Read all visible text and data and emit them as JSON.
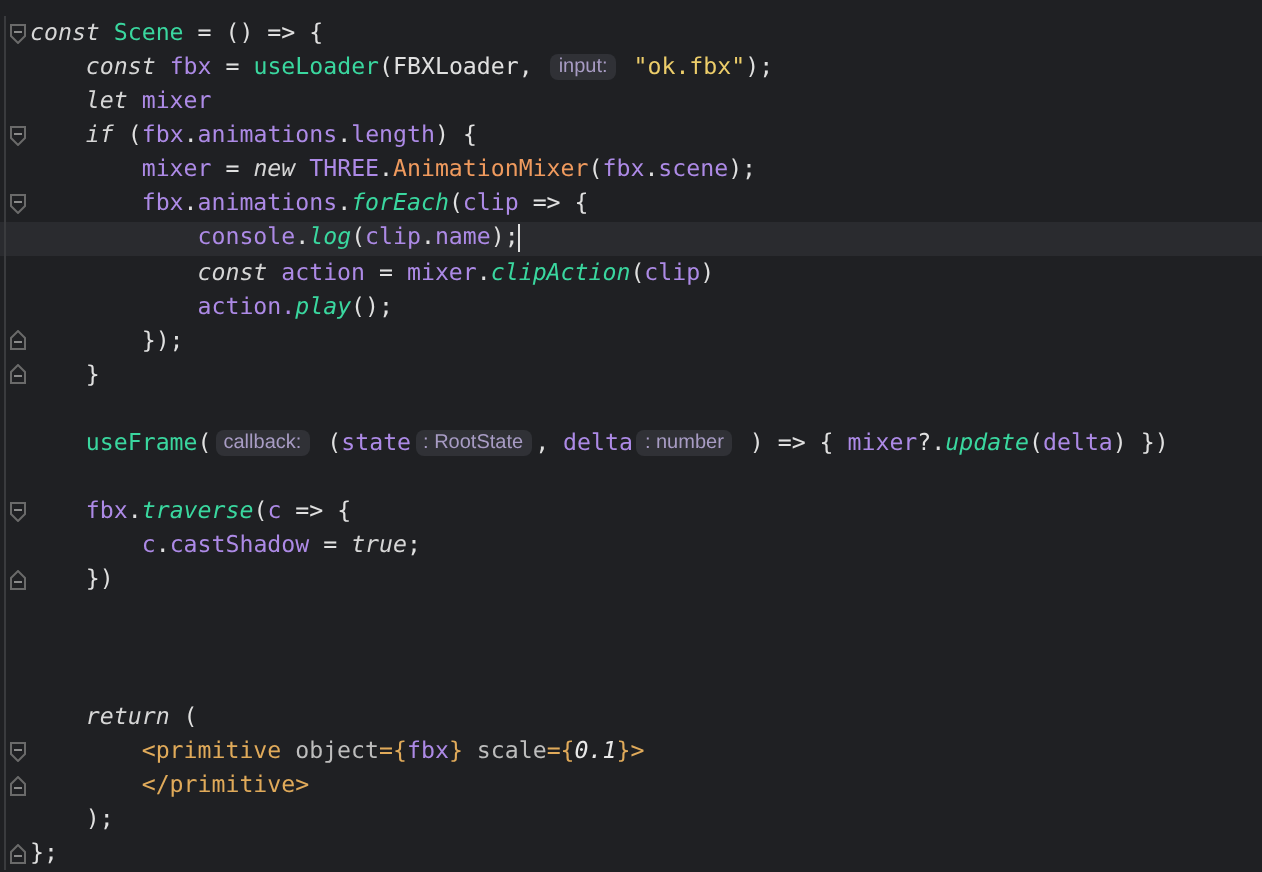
{
  "editor": {
    "lines": [
      {
        "fold_open": true,
        "fold_close": false,
        "current": false,
        "tokens": [
          {
            "text": "const ",
            "kind": "kw"
          },
          {
            "text": "Scene",
            "kind": "fn"
          },
          {
            "text": " = () => {",
            "kind": "plain"
          }
        ]
      },
      {
        "fold_open": false,
        "fold_close": false,
        "current": false,
        "tokens": [
          {
            "text": "    const ",
            "kind": "kw"
          },
          {
            "text": "fbx",
            "kind": "var"
          },
          {
            "text": " = ",
            "kind": "plain"
          },
          {
            "text": "useLoader",
            "kind": "fn"
          },
          {
            "text": "(FBXLoader, ",
            "kind": "plain"
          },
          {
            "text": "input:",
            "kind": "hint"
          },
          {
            "text": " \"ok.fbx\"",
            "kind": "str"
          },
          {
            "text": ");",
            "kind": "plain"
          }
        ]
      },
      {
        "fold_open": false,
        "fold_close": false,
        "current": false,
        "tokens": [
          {
            "text": "    let ",
            "kind": "kw"
          },
          {
            "text": "mixer",
            "kind": "var"
          }
        ]
      },
      {
        "fold_open": true,
        "fold_close": false,
        "current": false,
        "tokens": [
          {
            "text": "    if",
            "kind": "kw"
          },
          {
            "text": " (",
            "kind": "plain"
          },
          {
            "text": "fbx",
            "kind": "var"
          },
          {
            "text": ".",
            "kind": "plain"
          },
          {
            "text": "animations",
            "kind": "var"
          },
          {
            "text": ".",
            "kind": "plain"
          },
          {
            "text": "length",
            "kind": "var"
          },
          {
            "text": ") {",
            "kind": "plain"
          }
        ]
      },
      {
        "fold_open": false,
        "fold_close": false,
        "current": false,
        "tokens": [
          {
            "text": "        mixer",
            "kind": "var"
          },
          {
            "text": " = ",
            "kind": "plain"
          },
          {
            "text": "new ",
            "kind": "kw"
          },
          {
            "text": "THREE",
            "kind": "var"
          },
          {
            "text": ".",
            "kind": "plain"
          },
          {
            "text": "AnimationMixer",
            "kind": "cls"
          },
          {
            "text": "(",
            "kind": "plain"
          },
          {
            "text": "fbx",
            "kind": "var"
          },
          {
            "text": ".",
            "kind": "plain"
          },
          {
            "text": "scene",
            "kind": "var"
          },
          {
            "text": ");",
            "kind": "plain"
          }
        ]
      },
      {
        "fold_open": true,
        "fold_close": false,
        "current": false,
        "tokens": [
          {
            "text": "        fbx",
            "kind": "var"
          },
          {
            "text": ".",
            "kind": "plain"
          },
          {
            "text": "animations",
            "kind": "var"
          },
          {
            "text": ".",
            "kind": "plain"
          },
          {
            "text": "forEach",
            "kind": "method"
          },
          {
            "text": "(",
            "kind": "plain"
          },
          {
            "text": "clip",
            "kind": "var"
          },
          {
            "text": " => {",
            "kind": "plain"
          }
        ]
      },
      {
        "fold_open": false,
        "fold_close": false,
        "current": true,
        "tokens": [
          {
            "text": "            console",
            "kind": "var"
          },
          {
            "text": ".",
            "kind": "plain"
          },
          {
            "text": "log",
            "kind": "method"
          },
          {
            "text": "(",
            "kind": "plain"
          },
          {
            "text": "clip",
            "kind": "var"
          },
          {
            "text": ".",
            "kind": "plain"
          },
          {
            "text": "name",
            "kind": "var"
          },
          {
            "text": ");",
            "kind": "plain"
          }
        ]
      },
      {
        "fold_open": false,
        "fold_close": false,
        "current": false,
        "tokens": [
          {
            "text": "            const ",
            "kind": "kw"
          },
          {
            "text": "action",
            "kind": "var"
          },
          {
            "text": " = ",
            "kind": "plain"
          },
          {
            "text": "mixer",
            "kind": "var"
          },
          {
            "text": ".",
            "kind": "plain"
          },
          {
            "text": "clipAction",
            "kind": "method"
          },
          {
            "text": "(",
            "kind": "plain"
          },
          {
            "text": "clip",
            "kind": "var"
          },
          {
            "text": ")",
            "kind": "plain"
          }
        ]
      },
      {
        "fold_open": false,
        "fold_close": false,
        "current": false,
        "tokens": [
          {
            "text": "            action.",
            "kind": "var"
          },
          {
            "text": "play",
            "kind": "method"
          },
          {
            "text": "();",
            "kind": "plain"
          }
        ]
      },
      {
        "fold_open": false,
        "fold_close": true,
        "current": false,
        "tokens": [
          {
            "text": "        });",
            "kind": "plain"
          }
        ]
      },
      {
        "fold_open": false,
        "fold_close": true,
        "current": false,
        "tokens": [
          {
            "text": "    }",
            "kind": "plain"
          }
        ]
      },
      {
        "fold_open": false,
        "fold_close": false,
        "current": false
      },
      {
        "fold_open": false,
        "fold_close": false,
        "current": false,
        "tokens": [
          {
            "text": "    useFrame",
            "kind": "fn"
          },
          {
            "text": "(",
            "kind": "plain"
          },
          {
            "text": "callback:",
            "kind": "hint"
          },
          {
            "text": " (",
            "kind": "plain"
          },
          {
            "text": "state",
            "kind": "var"
          },
          {
            "text": ": RootState",
            "kind": "hint"
          },
          {
            "text": ", ",
            "kind": "plain"
          },
          {
            "text": "delta",
            "kind": "var"
          },
          {
            "text": ": number",
            "kind": "hint"
          },
          {
            "text": " ) => { ",
            "kind": "plain"
          },
          {
            "text": "mixer",
            "kind": "var"
          },
          {
            "text": "?.",
            "kind": "plain"
          },
          {
            "text": "update",
            "kind": "method"
          },
          {
            "text": "(",
            "kind": "plain"
          },
          {
            "text": "delta",
            "kind": "var"
          },
          {
            "text": ") })",
            "kind": "plain"
          }
        ]
      },
      {
        "fold_open": false,
        "fold_close": false,
        "current": false
      },
      {
        "fold_open": true,
        "fold_close": false,
        "current": false,
        "tokens": [
          {
            "text": "    fbx",
            "kind": "var"
          },
          {
            "text": ".",
            "kind": "plain"
          },
          {
            "text": "traverse",
            "kind": "method"
          },
          {
            "text": "(",
            "kind": "plain"
          },
          {
            "text": "c",
            "kind": "var"
          },
          {
            "text": " => {",
            "kind": "plain"
          }
        ]
      },
      {
        "fold_open": false,
        "fold_close": false,
        "current": false,
        "tokens": [
          {
            "text": "        c",
            "kind": "var"
          },
          {
            "text": ".",
            "kind": "plain"
          },
          {
            "text": "castShadow",
            "kind": "var"
          },
          {
            "text": " = ",
            "kind": "plain"
          },
          {
            "text": "true",
            "kind": "kw"
          },
          {
            "text": ";",
            "kind": "plain"
          }
        ]
      },
      {
        "fold_open": false,
        "fold_close": true,
        "current": false,
        "tokens": [
          {
            "text": "    })",
            "kind": "plain"
          }
        ]
      },
      {
        "fold_open": false,
        "fold_close": false,
        "current": false
      },
      {
        "fold_open": false,
        "fold_close": false,
        "current": false
      },
      {
        "fold_open": false,
        "fold_close": false,
        "current": false
      },
      {
        "fold_open": false,
        "fold_close": false,
        "current": false,
        "tokens": [
          {
            "text": "    return",
            "kind": "kw"
          },
          {
            "text": " (",
            "kind": "plain"
          }
        ]
      },
      {
        "fold_open": true,
        "fold_close": false,
        "current": false,
        "tokens": [
          {
            "text": "        <primitive",
            "kind": "tag"
          },
          {
            "text": " object",
            "kind": "attr"
          },
          {
            "text": "={",
            "kind": "tag"
          },
          {
            "text": "fbx",
            "kind": "var"
          },
          {
            "text": "}",
            "kind": "tag"
          },
          {
            "text": " scale",
            "kind": "attr"
          },
          {
            "text": "={",
            "kind": "tag"
          },
          {
            "text": "0.1",
            "kind": "num"
          },
          {
            "text": "}>",
            "kind": "tag"
          }
        ]
      },
      {
        "fold_open": false,
        "fold_close": true,
        "current": false,
        "tokens": [
          {
            "text": "        </primitive>",
            "kind": "tag"
          }
        ]
      },
      {
        "fold_open": false,
        "fold_close": false,
        "current": false,
        "tokens": [
          {
            "text": "    );",
            "kind": "plain"
          }
        ]
      },
      {
        "fold_open": false,
        "fold_close": true,
        "current": false,
        "tokens": [
          {
            "text": "};",
            "kind": "plain"
          }
        ]
      }
    ]
  }
}
